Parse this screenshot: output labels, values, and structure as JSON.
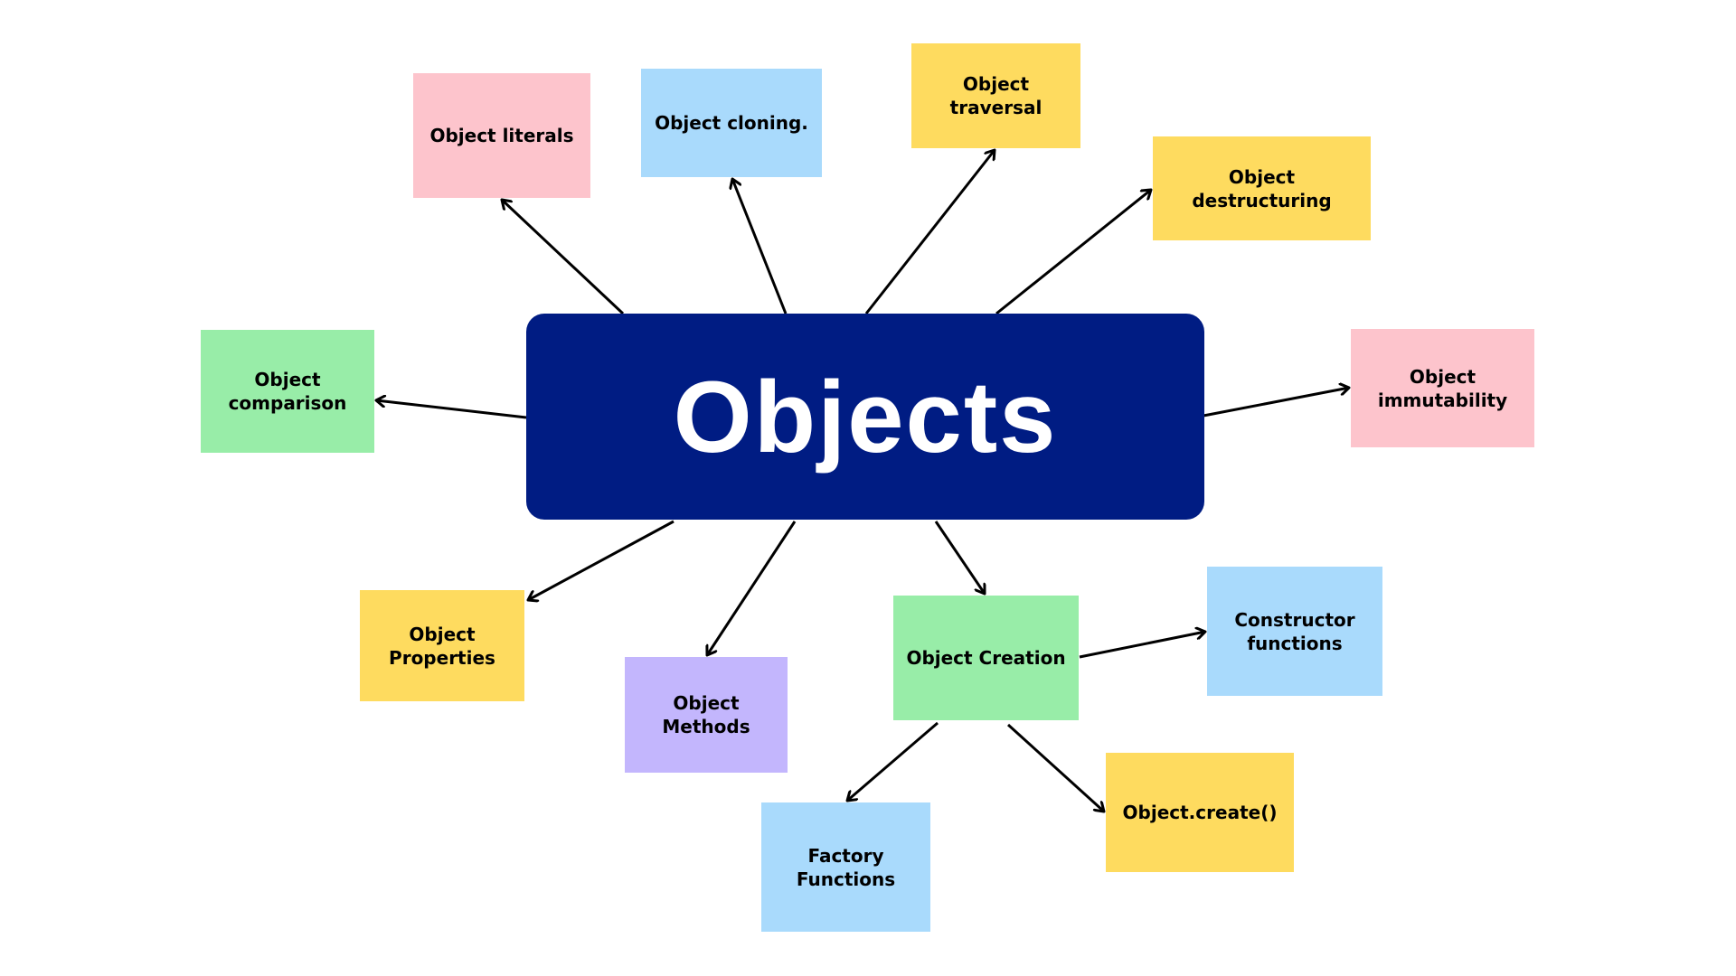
{
  "colors": {
    "center": "#001C83",
    "pink": "#FDC4CC",
    "blue": "#A9DAFC",
    "yellow": "#FEDB5F",
    "green": "#98EDA8",
    "purple": "#C3B6FD",
    "arrow": "#000000"
  },
  "center": {
    "label": "Objects"
  },
  "nodes": [
    {
      "id": "literals",
      "label": "Object literals",
      "color": "pink"
    },
    {
      "id": "cloning",
      "label": "Object cloning.",
      "color": "blue"
    },
    {
      "id": "traversal",
      "label": "Object\ntraversal",
      "color": "yellow"
    },
    {
      "id": "destructuring",
      "label": "Object\ndestructuring",
      "color": "yellow"
    },
    {
      "id": "comparison",
      "label": "Object\ncomparison",
      "color": "green"
    },
    {
      "id": "immutability",
      "label": "Object\nimmutability",
      "color": "pink"
    },
    {
      "id": "properties",
      "label": "Object\nProperties",
      "color": "yellow"
    },
    {
      "id": "methods",
      "label": "Object\nMethods",
      "color": "purple"
    },
    {
      "id": "creation",
      "label": "Object Creation",
      "color": "green"
    },
    {
      "id": "constructor",
      "label": "Constructor\nfunctions",
      "color": "blue"
    },
    {
      "id": "factory",
      "label": "Factory\nFunctions",
      "color": "blue"
    },
    {
      "id": "create",
      "label": "Object.create()",
      "color": "yellow"
    }
  ],
  "edges": [
    {
      "from": "center",
      "to": "literals"
    },
    {
      "from": "center",
      "to": "cloning"
    },
    {
      "from": "center",
      "to": "traversal"
    },
    {
      "from": "center",
      "to": "destructuring"
    },
    {
      "from": "center",
      "to": "comparison"
    },
    {
      "from": "center",
      "to": "immutability"
    },
    {
      "from": "center",
      "to": "properties"
    },
    {
      "from": "center",
      "to": "methods"
    },
    {
      "from": "center",
      "to": "creation"
    },
    {
      "from": "creation",
      "to": "constructor"
    },
    {
      "from": "creation",
      "to": "factory"
    },
    {
      "from": "creation",
      "to": "create"
    }
  ]
}
